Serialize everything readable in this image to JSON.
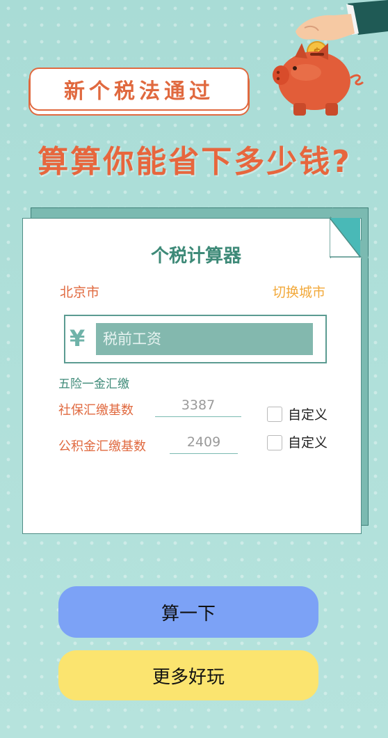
{
  "header": {
    "banner": "新个税法通过",
    "headline": "算算你能省下多少钱?"
  },
  "calculator": {
    "title": "个税计算器",
    "city": "北京市",
    "switch_city": "切换城市",
    "currency_symbol": "¥",
    "salary_placeholder": "税前工资",
    "section_label": "五险一金汇缴",
    "rows": [
      {
        "label": "社保汇缴基数",
        "value": "3387",
        "custom_label": "自定义"
      },
      {
        "label": "公积金汇缴基数",
        "value": "2409",
        "custom_label": "自定义"
      }
    ]
  },
  "actions": {
    "calculate": "算一下",
    "more": "更多好玩"
  },
  "icons": {
    "decor": "piggy-bank-icon",
    "coin": "coin-icon"
  },
  "colors": {
    "accent_orange": "#e0693f",
    "teal": "#3e8a78",
    "gold": "#f2a93b",
    "calc_button": "#7ca2f6",
    "more_button": "#fbe46f"
  }
}
